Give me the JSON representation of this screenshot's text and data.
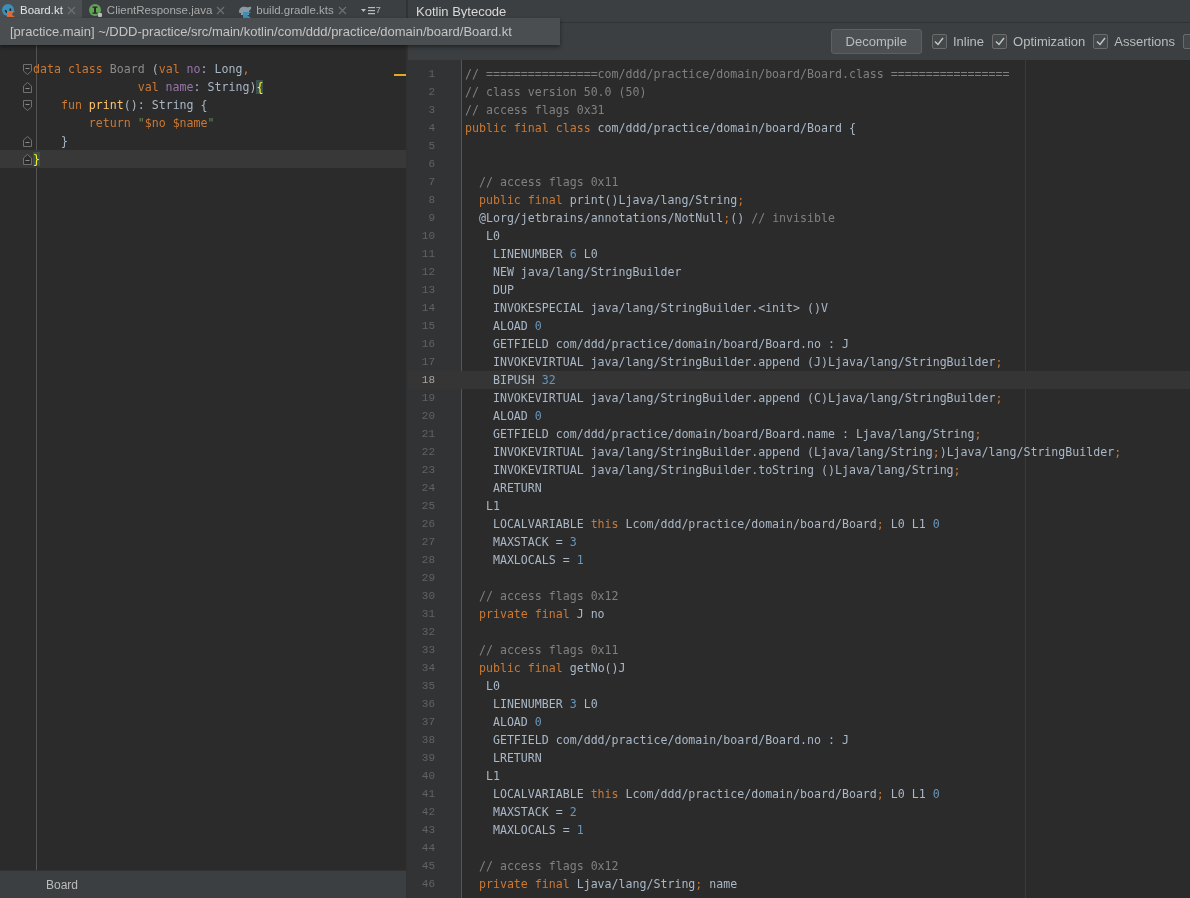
{
  "tabs": [
    {
      "label": "Board.kt",
      "kind": "kotlin",
      "selected": true
    },
    {
      "label": "ClientResponse.java",
      "kind": "interface",
      "selected": false
    },
    {
      "label": "build.gradle.kts",
      "kind": "gradle",
      "selected": false
    }
  ],
  "tab_overflow": {
    "count": "7"
  },
  "tooltip": "[practice.main] ~/DDD-practice/src/main/kotlin/com/ddd/practice/domain/board/Board.kt",
  "tool_window": {
    "title": "Kotlin Bytecode"
  },
  "toolbar": {
    "button": "Decompile",
    "options": [
      {
        "label": "Inline",
        "checked": true
      },
      {
        "label": "Optimization",
        "checked": true
      },
      {
        "label": "Assertions",
        "checked": true
      },
      {
        "checked": false
      }
    ]
  },
  "source": {
    "lines": [
      {
        "kind": "opener",
        "current": false,
        "tokens": [
          {
            "kind": "keyword",
            "text": "data class"
          },
          {
            "kind": "muted",
            "text": " Board "
          },
          {
            "kind": "plain",
            "text": "("
          },
          {
            "kind": "keyword",
            "text": "val"
          },
          {
            "kind": "field",
            "text": " no"
          },
          {
            "kind": "plain",
            "text": ": Long"
          },
          {
            "kind": "keyword",
            "text": ","
          }
        ]
      },
      {
        "kind": "closer",
        "current": false,
        "tokens": [
          {
            "kind": "keyword",
            "text": "               val"
          },
          {
            "kind": "field",
            "text": " name"
          },
          {
            "kind": "plain",
            "text": ": String)"
          },
          {
            "kind": "brace",
            "text": "{"
          }
        ]
      },
      {
        "kind": "opener",
        "current": false,
        "tokens": [
          {
            "kind": "keyword",
            "text": "    fun"
          },
          {
            "kind": "function",
            "text": " print"
          },
          {
            "kind": "plain",
            "text": "(): String {"
          }
        ]
      },
      {
        "kind": "plain",
        "current": false,
        "tokens": [
          {
            "kind": "keyword",
            "text": "        return"
          },
          {
            "kind": "string",
            "text": " \""
          },
          {
            "kind": "keyword",
            "text": "$no"
          },
          {
            "kind": "keyword",
            "text": " $name"
          },
          {
            "kind": "string",
            "text": "\""
          }
        ]
      },
      {
        "kind": "closer",
        "current": false,
        "tokens": [
          {
            "kind": "plain",
            "text": "    }"
          }
        ]
      },
      {
        "kind": "closer",
        "current": true,
        "tokens": [
          {
            "kind": "brace",
            "text": "}"
          }
        ]
      }
    ]
  },
  "bytecode": {
    "lines": [
      {
        "number": "1",
        "current": false,
        "tokens": [
          {
            "kind": "comment",
            "text": "// ================com/ddd/practice/domain/board/Board.class ================="
          }
        ]
      },
      {
        "number": "2",
        "current": false,
        "tokens": [
          {
            "kind": "comment",
            "text": "// class version 50.0 (50)"
          }
        ]
      },
      {
        "number": "3",
        "current": false,
        "tokens": [
          {
            "kind": "comment",
            "text": "// access flags 0x31"
          }
        ]
      },
      {
        "number": "4",
        "current": false,
        "tokens": [
          {
            "kind": "keyword",
            "text": "public final class"
          },
          {
            "kind": "plain",
            "text": " com/ddd/practice/domain/board/Board {"
          }
        ]
      },
      {
        "number": "5",
        "current": false
      },
      {
        "number": "6",
        "current": false
      },
      {
        "number": "7",
        "current": false,
        "tokens": [
          {
            "kind": "comment",
            "text": "  // access flags 0x11"
          }
        ]
      },
      {
        "number": "8",
        "current": false,
        "tokens": [
          {
            "kind": "keyword",
            "text": "  public final"
          },
          {
            "kind": "plain",
            "text": " print()Ljava/lang/String"
          },
          {
            "kind": "keyword",
            "text": ";"
          }
        ]
      },
      {
        "number": "9",
        "current": false,
        "tokens": [
          {
            "kind": "plain",
            "text": "  @Lorg/jetbrains/annotations/NotNull"
          },
          {
            "kind": "keyword",
            "text": ";"
          },
          {
            "kind": "plain",
            "text": "() "
          },
          {
            "kind": "comment",
            "text": "// invisible"
          }
        ]
      },
      {
        "number": "10",
        "current": false,
        "tokens": [
          {
            "kind": "plain",
            "text": "   L0"
          }
        ]
      },
      {
        "number": "11",
        "current": false,
        "tokens": [
          {
            "kind": "plain",
            "text": "    LINENUMBER "
          },
          {
            "kind": "number",
            "text": "6"
          },
          {
            "kind": "plain",
            "text": " L0"
          }
        ]
      },
      {
        "number": "12",
        "current": false,
        "tokens": [
          {
            "kind": "plain",
            "text": "    NEW java/lang/StringBuilder"
          }
        ]
      },
      {
        "number": "13",
        "current": false,
        "tokens": [
          {
            "kind": "plain",
            "text": "    DUP"
          }
        ]
      },
      {
        "number": "14",
        "current": false,
        "tokens": [
          {
            "kind": "plain",
            "text": "    INVOKESPECIAL java/lang/StringBuilder.<init> ()V"
          }
        ]
      },
      {
        "number": "15",
        "current": false,
        "tokens": [
          {
            "kind": "plain",
            "text": "    ALOAD "
          },
          {
            "kind": "number",
            "text": "0"
          }
        ]
      },
      {
        "number": "16",
        "current": false,
        "tokens": [
          {
            "kind": "plain",
            "text": "    GETFIELD com/ddd/practice/domain/board/Board.no : J"
          }
        ]
      },
      {
        "number": "17",
        "current": false,
        "tokens": [
          {
            "kind": "plain",
            "text": "    INVOKEVIRTUAL java/lang/StringBuilder.append (J)Ljava/lang/StringBuilder"
          },
          {
            "kind": "keyword",
            "text": ";"
          }
        ]
      },
      {
        "number": "18",
        "current": true,
        "tokens": [
          {
            "kind": "plain",
            "text": "    BIPUSH "
          },
          {
            "kind": "number",
            "text": "32"
          }
        ]
      },
      {
        "number": "19",
        "current": false,
        "tokens": [
          {
            "kind": "plain",
            "text": "    INVOKEVIRTUAL java/lang/StringBuilder.append (C)Ljava/lang/StringBuilder"
          },
          {
            "kind": "keyword",
            "text": ";"
          }
        ]
      },
      {
        "number": "20",
        "current": false,
        "tokens": [
          {
            "kind": "plain",
            "text": "    ALOAD "
          },
          {
            "kind": "number",
            "text": "0"
          }
        ]
      },
      {
        "number": "21",
        "current": false,
        "tokens": [
          {
            "kind": "plain",
            "text": "    GETFIELD com/ddd/practice/domain/board/Board.name : Ljava/lang/String"
          },
          {
            "kind": "keyword",
            "text": ";"
          }
        ]
      },
      {
        "number": "22",
        "current": false,
        "tokens": [
          {
            "kind": "plain",
            "text": "    INVOKEVIRTUAL java/lang/StringBuilder.append (Ljava/lang/String"
          },
          {
            "kind": "keyword",
            "text": ";"
          },
          {
            "kind": "plain",
            "text": ")Ljava/lang/StringBuilder"
          },
          {
            "kind": "keyword",
            "text": ";"
          }
        ]
      },
      {
        "number": "23",
        "current": false,
        "tokens": [
          {
            "kind": "plain",
            "text": "    INVOKEVIRTUAL java/lang/StringBuilder.toString ()Ljava/lang/String"
          },
          {
            "kind": "keyword",
            "text": ";"
          }
        ]
      },
      {
        "number": "24",
        "current": false,
        "tokens": [
          {
            "kind": "plain",
            "text": "    ARETURN"
          }
        ]
      },
      {
        "number": "25",
        "current": false,
        "tokens": [
          {
            "kind": "plain",
            "text": "   L1"
          }
        ]
      },
      {
        "number": "26",
        "current": false,
        "tokens": [
          {
            "kind": "plain",
            "text": "    LOCALVARIABLE "
          },
          {
            "kind": "keyword",
            "text": "this"
          },
          {
            "kind": "plain",
            "text": " Lcom/ddd/practice/domain/board/Board"
          },
          {
            "kind": "keyword",
            "text": ";"
          },
          {
            "kind": "plain",
            "text": " L0 L1 "
          },
          {
            "kind": "number",
            "text": "0"
          }
        ]
      },
      {
        "number": "27",
        "current": false,
        "tokens": [
          {
            "kind": "plain",
            "text": "    MAXSTACK = "
          },
          {
            "kind": "number",
            "text": "3"
          }
        ]
      },
      {
        "number": "28",
        "current": false,
        "tokens": [
          {
            "kind": "plain",
            "text": "    MAXLOCALS = "
          },
          {
            "kind": "number",
            "text": "1"
          }
        ]
      },
      {
        "number": "29",
        "current": false
      },
      {
        "number": "30",
        "current": false,
        "tokens": [
          {
            "kind": "comment",
            "text": "  // access flags 0x12"
          }
        ]
      },
      {
        "number": "31",
        "current": false,
        "tokens": [
          {
            "kind": "keyword",
            "text": "  private final"
          },
          {
            "kind": "plain",
            "text": " J no"
          }
        ]
      },
      {
        "number": "32",
        "current": false
      },
      {
        "number": "33",
        "current": false,
        "tokens": [
          {
            "kind": "comment",
            "text": "  // access flags 0x11"
          }
        ]
      },
      {
        "number": "34",
        "current": false,
        "tokens": [
          {
            "kind": "keyword",
            "text": "  public final"
          },
          {
            "kind": "plain",
            "text": " getNo()J"
          }
        ]
      },
      {
        "number": "35",
        "current": false,
        "tokens": [
          {
            "kind": "plain",
            "text": "   L0"
          }
        ]
      },
      {
        "number": "36",
        "current": false,
        "tokens": [
          {
            "kind": "plain",
            "text": "    LINENUMBER "
          },
          {
            "kind": "number",
            "text": "3"
          },
          {
            "kind": "plain",
            "text": " L0"
          }
        ]
      },
      {
        "number": "37",
        "current": false,
        "tokens": [
          {
            "kind": "plain",
            "text": "    ALOAD "
          },
          {
            "kind": "number",
            "text": "0"
          }
        ]
      },
      {
        "number": "38",
        "current": false,
        "tokens": [
          {
            "kind": "plain",
            "text": "    GETFIELD com/ddd/practice/domain/board/Board.no : J"
          }
        ]
      },
      {
        "number": "39",
        "current": false,
        "tokens": [
          {
            "kind": "plain",
            "text": "    LRETURN"
          }
        ]
      },
      {
        "number": "40",
        "current": false,
        "tokens": [
          {
            "kind": "plain",
            "text": "   L1"
          }
        ]
      },
      {
        "number": "41",
        "current": false,
        "tokens": [
          {
            "kind": "plain",
            "text": "    LOCALVARIABLE "
          },
          {
            "kind": "keyword",
            "text": "this"
          },
          {
            "kind": "plain",
            "text": " Lcom/ddd/practice/domain/board/Board"
          },
          {
            "kind": "keyword",
            "text": ";"
          },
          {
            "kind": "plain",
            "text": " L0 L1 "
          },
          {
            "kind": "number",
            "text": "0"
          }
        ]
      },
      {
        "number": "42",
        "current": false,
        "tokens": [
          {
            "kind": "plain",
            "text": "    MAXSTACK = "
          },
          {
            "kind": "number",
            "text": "2"
          }
        ]
      },
      {
        "number": "43",
        "current": false,
        "tokens": [
          {
            "kind": "plain",
            "text": "    MAXLOCALS = "
          },
          {
            "kind": "number",
            "text": "1"
          }
        ]
      },
      {
        "number": "44",
        "current": false
      },
      {
        "number": "45",
        "current": false,
        "tokens": [
          {
            "kind": "comment",
            "text": "  // access flags 0x12"
          }
        ]
      },
      {
        "number": "46",
        "current": false,
        "tokens": [
          {
            "kind": "keyword",
            "text": "  private final"
          },
          {
            "kind": "plain",
            "text": " Ljava/lang/String"
          },
          {
            "kind": "keyword",
            "text": ";"
          },
          {
            "kind": "plain",
            "text": " name"
          }
        ]
      }
    ]
  },
  "breadcrumb": "Board"
}
